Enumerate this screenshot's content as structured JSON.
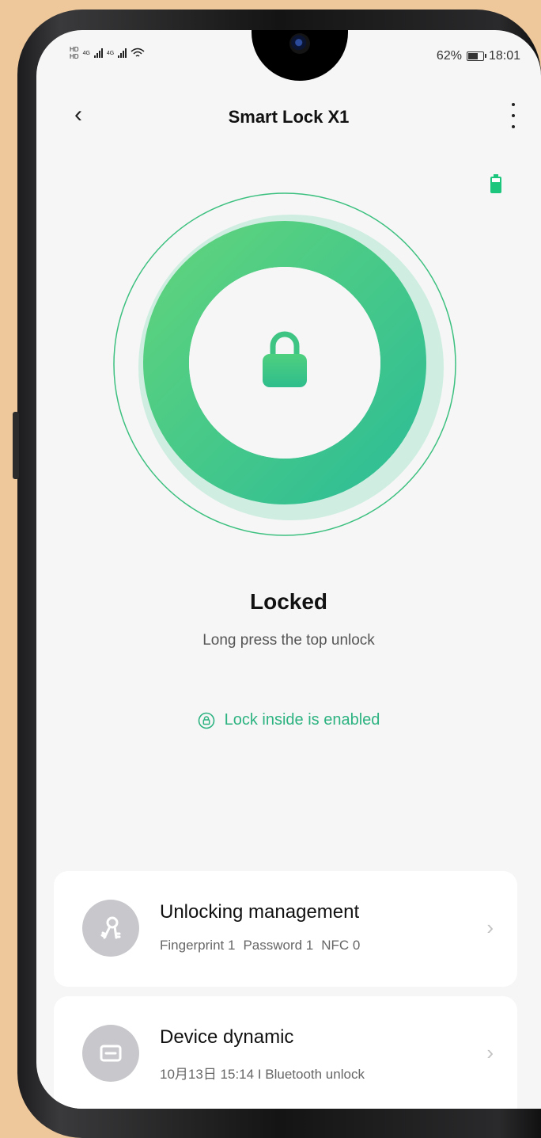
{
  "status_bar": {
    "sim1": "HD",
    "sim2": "HD",
    "net1": "4G",
    "net2": "4G",
    "battery_percent": "62%",
    "battery_level": 0.62,
    "time": "18:01"
  },
  "header": {
    "back_icon": "chevron-left-icon",
    "title": "Smart Lock X1",
    "more_icon": "more-vertical-icon"
  },
  "lock": {
    "state": "Locked",
    "hint": "Long press the top unlock",
    "inside_status": "Lock inside is enabled"
  },
  "colors": {
    "accent": "#2DB381",
    "ring_start": "#5ED37D",
    "ring_end": "#2FBE95",
    "battery": "#1CC77D"
  },
  "cards": [
    {
      "title": "Unlocking management",
      "details": [
        "Fingerprint 1",
        "Password 1",
        "NFC 0"
      ],
      "icon": "keys-icon"
    },
    {
      "title": "Device dynamic",
      "detail": "10月13日 15:14 I Bluetooth unlock",
      "icon": "message-card-icon"
    }
  ]
}
